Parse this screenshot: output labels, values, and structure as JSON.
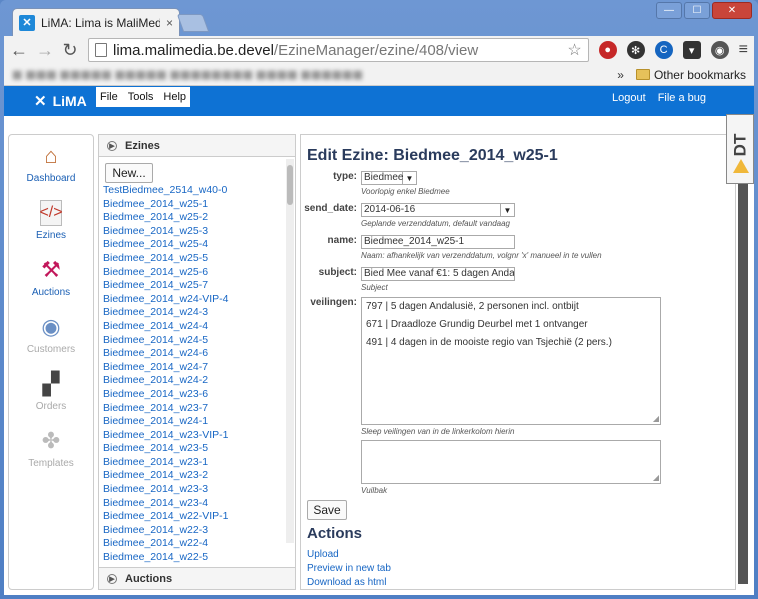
{
  "browser": {
    "tab_title": "LiMA: Lima is MaliMedia",
    "tab_close": "×",
    "url_host": "lima.malimedia.be.devel",
    "url_path": "/EzineManager/ezine/408/view",
    "bookmarks_more": "»",
    "other_bookmarks": "Other bookmarks",
    "window_buttons": [
      "—",
      "☐",
      "✕"
    ]
  },
  "app": {
    "logo": "LiMA",
    "menu": [
      "File",
      "Tools",
      "Help"
    ],
    "toplinks": [
      "Logout",
      "File a bug"
    ]
  },
  "sidebar": {
    "items": [
      {
        "label": "Dashboard",
        "icon": "house-icon",
        "state": "active"
      },
      {
        "label": "Ezines",
        "icon": "document-code-icon",
        "state": "active"
      },
      {
        "label": "Auctions",
        "icon": "gavel-icon",
        "state": "active"
      },
      {
        "label": "Customers",
        "icon": "person-icon",
        "state": "dim"
      },
      {
        "label": "Orders",
        "icon": "boxes-icon",
        "state": "dim"
      },
      {
        "label": "Templates",
        "icon": "puzzle-icon",
        "state": "dim"
      }
    ]
  },
  "ezines": {
    "title": "Ezines",
    "new_label": "New...",
    "items": [
      "TestBiedmee_2514_w40-0",
      "Biedmee_2014_w25-1",
      "Biedmee_2014_w25-2",
      "Biedmee_2014_w25-3",
      "Biedmee_2014_w25-4",
      "Biedmee_2014_w25-5",
      "Biedmee_2014_w25-6",
      "Biedmee_2014_w25-7",
      "Biedmee_2014_w24-VIP-4",
      "Biedmee_2014_w24-3",
      "Biedmee_2014_w24-4",
      "Biedmee_2014_w24-5",
      "Biedmee_2014_w24-6",
      "Biedmee_2014_w24-7",
      "Biedmee_2014_w24-2",
      "Biedmee_2014_w23-6",
      "Biedmee_2014_w23-7",
      "Biedmee_2014_w24-1",
      "Biedmee_2014_w23-VIP-1",
      "Biedmee_2014_w23-5",
      "Biedmee_2014_w23-1",
      "Biedmee_2014_w23-2",
      "Biedmee_2014_w23-3",
      "Biedmee_2014_w23-4",
      "Biedmee_2014_w22-VIP-1",
      "Biedmee_2014_w22-3",
      "Biedmee_2014_w22-4",
      "Biedmee_2014_w22-5"
    ],
    "auctions_title": "Auctions"
  },
  "edit": {
    "title": "Edit Ezine: Biedmee_2014_w25-1",
    "type_label": "type:",
    "type_value": "Biedmee",
    "type_hint": "Voorlopig enkel Biedmee",
    "send_date_label": "send_date:",
    "send_date_value": "2014-06-16",
    "send_date_hint": "Geplande verzenddatum, default vandaag",
    "name_label": "name:",
    "name_value": "Biedmee_2014_w25-1",
    "name_hint": "Naam: afhankelijk van verzenddatum, volgnr 'x' manueel in te vullen",
    "subject_label": "subject:",
    "subject_value": "Bied Mee vanaf €1: 5 dagen Anda",
    "subject_hint": "Subject",
    "veilingen_label": "veilingen:",
    "veilingen": [
      "797 | 5 dagen Andalusië, 2 personen incl. ontbijt",
      "671 | Draadloze Grundig Deurbel met 1 ontvanger",
      "491 | 4 dagen in de mooiste regio van Tsjechië (2 pers.)"
    ],
    "veilingen_hint": "Sleep veilingen van in de linkerkolom hierin",
    "vuilbak_hint": "Vuilbak",
    "save_label": "Save",
    "actions_title": "Actions",
    "actions": [
      "Upload",
      "Preview in new tab",
      "Download as html"
    ]
  },
  "dt_badge": "DT"
}
